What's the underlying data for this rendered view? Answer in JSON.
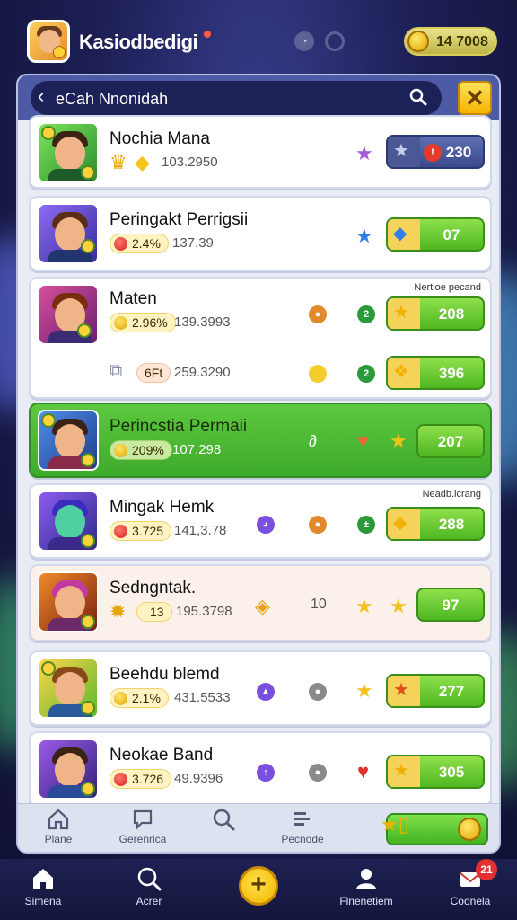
{
  "header": {
    "app_name": "Kasiodbedigi",
    "coins": "14 7008"
  },
  "search": {
    "label": "eCah Nnonidah"
  },
  "rows": [
    {
      "title": "Nochia Mana",
      "pill": "",
      "stat": "103.2950",
      "button": "230",
      "thumb_color": "#3fbd48"
    },
    {
      "title": "Peringakt Perrigsii",
      "pill": "2.4%",
      "stat": "137.39",
      "button": "07",
      "thumb_color": "#6b4ed2"
    },
    {
      "title": "Maten",
      "pill": "2.96%",
      "stat": "139.3993",
      "button": "208",
      "sub_pill": "6Ft",
      "sub_stat": "259.3290",
      "sub_button": "396",
      "note": "Nertioe pecand",
      "thumb_color": "#c0347a"
    },
    {
      "title": "Perincstia Permaii",
      "pill": "209%",
      "stat": "107.298",
      "button": "207",
      "thumb_color": "#2f6ad0"
    },
    {
      "title": "Mingak Hemk",
      "pill": "3.725",
      "stat": "141,3.78",
      "button": "288",
      "note": "Neadb.icrang",
      "thumb_color": "#7a37c9"
    },
    {
      "title": "Sedngntak.",
      "pill": "13",
      "stat": "195.3798",
      "mid": "10",
      "button": "97",
      "thumb_color": "#c44624"
    },
    {
      "title": "Beehdu blemd",
      "pill": "2.1%",
      "stat": "431.5533",
      "button": "277",
      "thumb_color": "#e8a824"
    },
    {
      "title": "Neokae Band",
      "pill": "3.726",
      "stat": "49.9396",
      "button": "305",
      "thumb_color": "#6c3bb8"
    }
  ],
  "panel_tabs": [
    {
      "label": "Plane"
    },
    {
      "label": "Gerenrica"
    },
    {
      "label": ""
    },
    {
      "label": "Pecnode"
    }
  ],
  "bottom_nav": [
    {
      "label": "Simena"
    },
    {
      "label": "Acrer"
    },
    {
      "label": "Flnenetiem"
    },
    {
      "label": "Coonela"
    }
  ],
  "notification_count": "21",
  "colors": {
    "accent_green": "#4eb722",
    "accent_gold": "#f4b400",
    "panel_head": "#4d5aa6"
  }
}
